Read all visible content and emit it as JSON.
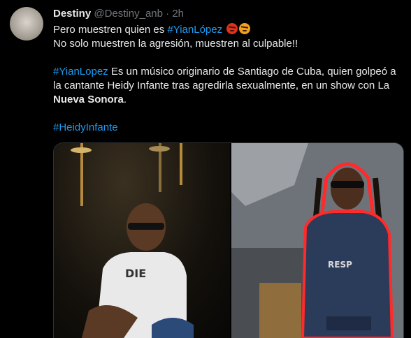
{
  "tweet": {
    "author_name": "Destiny",
    "handle": "@Destiny_anb",
    "separator": "·",
    "time": "2h",
    "avatar_text": "Destiny Anb",
    "line1_prefix": "Pero muestren quien es ",
    "line1_hashtag": "#YianLópez",
    "line2": "No solo muestren la agresión, muestren al culpable!!",
    "para2_hashtag": "#YianLopez",
    "para2_text_a": " Es un músico originario de Santiago de Cuba, quien golpeó a la cantante Heidy Infante tras agredirla sexualmente, en un show con La ",
    "para2_bold": "Nueva Sonora",
    "para2_text_b": ".",
    "para3_hashtag": "#HeidyInfante",
    "emojis": [
      "angry-red-face",
      "angry-face"
    ]
  },
  "colors": {
    "background": "#000000",
    "text": "#e7e9ea",
    "secondary": "#71767b",
    "link": "#1d9bf0"
  }
}
